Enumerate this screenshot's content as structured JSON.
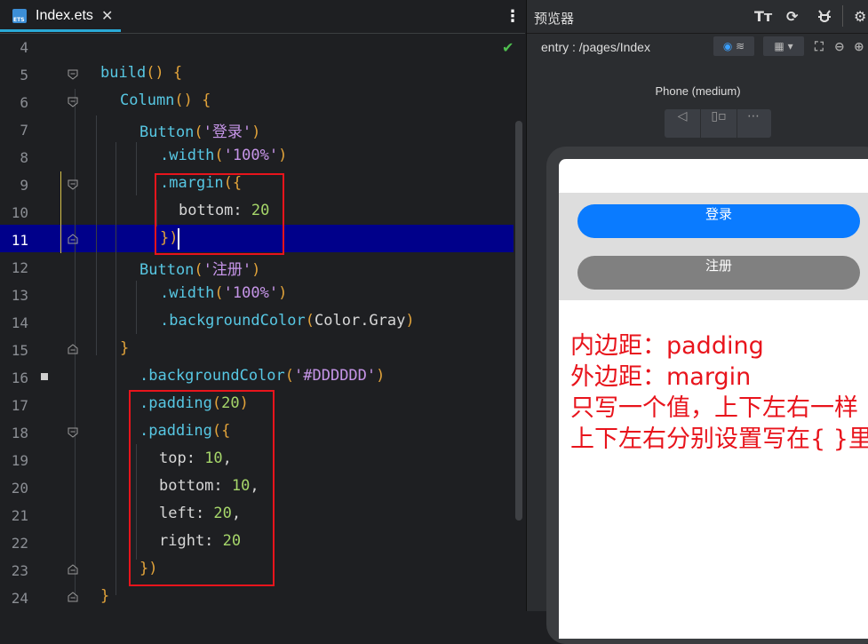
{
  "editor": {
    "tab_label": "Index.ets",
    "tab_icon_text": "ETS",
    "close_glyph": "✕",
    "more_glyph": "⋮",
    "check_glyph": "✔"
  },
  "lines": [
    {
      "num": "4"
    },
    {
      "num": "5"
    },
    {
      "num": "6"
    },
    {
      "num": "7"
    },
    {
      "num": "8"
    },
    {
      "num": "9"
    },
    {
      "num": "10"
    },
    {
      "num": "11"
    },
    {
      "num": "12"
    },
    {
      "num": "13"
    },
    {
      "num": "14"
    },
    {
      "num": "15"
    },
    {
      "num": "16"
    },
    {
      "num": "17"
    },
    {
      "num": "18"
    },
    {
      "num": "19"
    },
    {
      "num": "20"
    },
    {
      "num": "21"
    },
    {
      "num": "22"
    },
    {
      "num": "23"
    },
    {
      "num": "24"
    }
  ],
  "code": {
    "l5": {
      "fn": "build",
      "tail": "() {"
    },
    "l6": {
      "fn": "Column",
      "tail": "() {"
    },
    "l7": {
      "fn": "Button",
      "open": "(",
      "str": "'登录'",
      "close": ")"
    },
    "l8": {
      "fn": ".width",
      "open": "(",
      "str": "'100%'",
      "close": ")"
    },
    "l9": {
      "fn": ".margin",
      "tail": "({"
    },
    "l10": {
      "prop": "bottom: ",
      "num": "20"
    },
    "l11": {
      "tail": "})"
    },
    "l12": {
      "fn": "Button",
      "open": "(",
      "str": "'注册'",
      "close": ")"
    },
    "l13": {
      "fn": ".width",
      "open": "(",
      "str": "'100%'",
      "close": ")"
    },
    "l14": {
      "fn": ".backgroundColor",
      "open": "(",
      "arg": "Color.Gray",
      "close": ")"
    },
    "l15": {
      "tail": "}"
    },
    "l16": {
      "fn": ".backgroundColor",
      "open": "(",
      "str": "'#DDDDDD'",
      "close": ")"
    },
    "l17": {
      "fn": ".padding",
      "open": "(",
      "num": "20",
      "close": ")"
    },
    "l18": {
      "fn": ".padding",
      "tail": "({"
    },
    "l19": {
      "prop": "top: ",
      "num": "10",
      "end": ","
    },
    "l20": {
      "prop": "bottom: ",
      "num": "10",
      "end": ","
    },
    "l21": {
      "prop": "left: ",
      "num": "20",
      "end": ","
    },
    "l22": {
      "prop": "right: ",
      "num": "20"
    },
    "l23": {
      "tail": "})"
    },
    "l24": {
      "tail": "}"
    }
  },
  "preview": {
    "title": "预览器",
    "route": "entry : /pages/Index",
    "device": "Phone (medium)",
    "btn_login": "登录",
    "btn_register": "注册"
  },
  "annotation": {
    "line1": "内边距：padding",
    "line2": "外边距：margin",
    "line3": "只写一个值，上下左右一样",
    "line4": "上下左右分别设置写在{ }里"
  },
  "colors": {
    "accent": "#2aa9d6",
    "current_line": "#00008a",
    "annotation_red": "#e8141c",
    "login_blue": "#0a7bff",
    "gray": "#808080",
    "column_bg": "#DDDDDD"
  }
}
